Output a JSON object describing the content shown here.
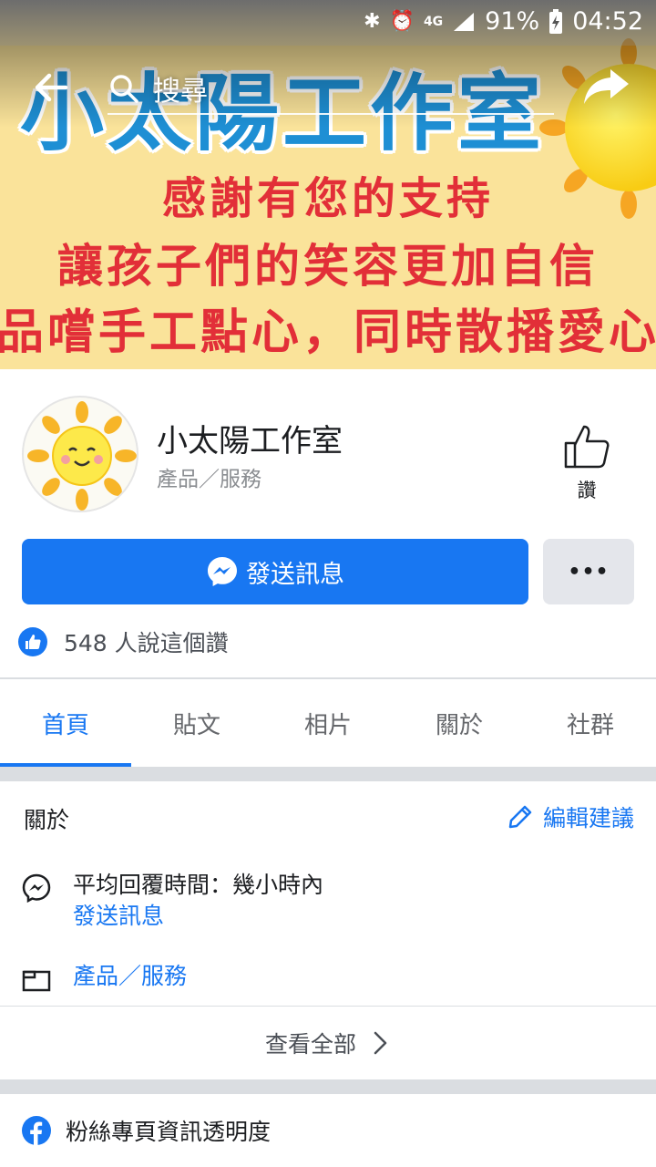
{
  "status_bar": {
    "battery": "91%",
    "time": "04:52",
    "network": "4G"
  },
  "cover": {
    "title": "小太陽工作室",
    "line1": "感謝有您的支持",
    "line2": "讓孩子們的笑容更加自信",
    "line3": "品嚐手工點心，同時散播愛心"
  },
  "topbar": {
    "search_label": "搜尋"
  },
  "profile": {
    "name": "小太陽工作室",
    "category": "產品／服務",
    "like_label": "讚"
  },
  "actions": {
    "send_message_label": "發送訊息",
    "more_label": "•••"
  },
  "likes": {
    "text": "548 人說這個讚"
  },
  "tabs": [
    {
      "label": "首頁",
      "active": true
    },
    {
      "label": "貼文",
      "active": false
    },
    {
      "label": "相片",
      "active": false
    },
    {
      "label": "關於",
      "active": false
    },
    {
      "label": "社群",
      "active": false
    }
  ],
  "about": {
    "title": "關於",
    "edit_label": "編輯建議",
    "response_time": "平均回覆時間：幾小時內",
    "send_message_link": "發送訊息",
    "category_link": "產品／服務",
    "see_all_label": "查看全部"
  },
  "transparency": {
    "label": "粉絲專頁資訊透明度"
  },
  "colors": {
    "brand_blue": "#1877f2",
    "cover_yellow": "#fae39a",
    "cover_red": "#e22f38",
    "cover_title_blue": "#1e8fd4"
  }
}
